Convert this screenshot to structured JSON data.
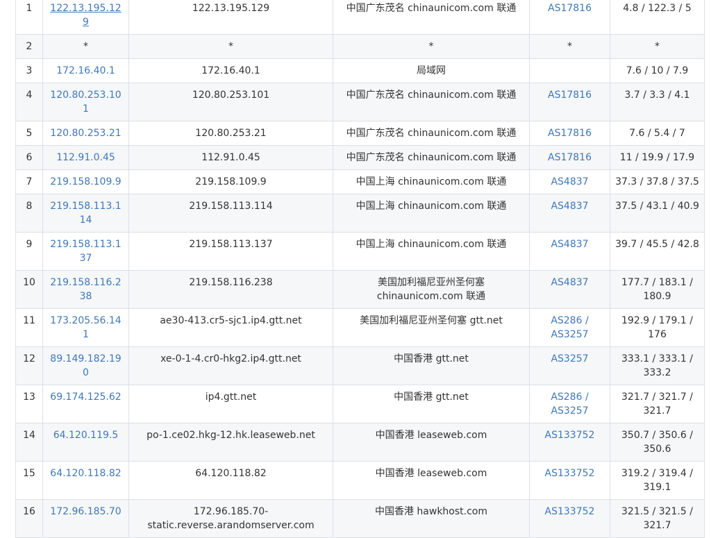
{
  "rows": [
    {
      "num": "1",
      "ip": "122.13.195.129",
      "host": "122.13.195.129",
      "loc": "中国广东茂名 chinaunicom.com 联通",
      "asn": "AS17816",
      "time": "4.8 / 122.3 / 5"
    },
    {
      "num": "2",
      "ip": "*",
      "host": "*",
      "loc": "*",
      "asn": "*",
      "time": "*"
    },
    {
      "num": "3",
      "ip": "172.16.40.1",
      "host": "172.16.40.1",
      "loc": "局域网",
      "asn": "",
      "time": "7.6 / 10 / 7.9"
    },
    {
      "num": "4",
      "ip": "120.80.253.101",
      "host": "120.80.253.101",
      "loc": "中国广东茂名 chinaunicom.com 联通",
      "asn": "AS17816",
      "time": "3.7 / 3.3 / 4.1"
    },
    {
      "num": "5",
      "ip": "120.80.253.21",
      "host": "120.80.253.21",
      "loc": "中国广东茂名 chinaunicom.com 联通",
      "asn": "AS17816",
      "time": "7.6 / 5.4 / 7"
    },
    {
      "num": "6",
      "ip": "112.91.0.45",
      "host": "112.91.0.45",
      "loc": "中国广东茂名 chinaunicom.com 联通",
      "asn": "AS17816",
      "time": "11 / 19.9 / 17.9"
    },
    {
      "num": "7",
      "ip": "219.158.109.9",
      "host": "219.158.109.9",
      "loc": "中国上海 chinaunicom.com 联通",
      "asn": "AS4837",
      "time": "37.3 / 37.8 / 37.5"
    },
    {
      "num": "8",
      "ip": "219.158.113.114",
      "host": "219.158.113.114",
      "loc": "中国上海 chinaunicom.com 联通",
      "asn": "AS4837",
      "time": "37.5 / 43.1 / 40.9"
    },
    {
      "num": "9",
      "ip": "219.158.113.137",
      "host": "219.158.113.137",
      "loc": "中国上海 chinaunicom.com 联通",
      "asn": "AS4837",
      "time": "39.7 / 45.5 / 42.8"
    },
    {
      "num": "10",
      "ip": "219.158.116.238",
      "host": "219.158.116.238",
      "loc": "美国加利福尼亚州圣何塞 chinaunicom.com 联通",
      "asn": "AS4837",
      "time": "177.7 / 183.1 / 180.9"
    },
    {
      "num": "11",
      "ip": "173.205.56.141",
      "host": "ae30-413.cr5-sjc1.ip4.gtt.net",
      "loc": "美国加利福尼亚州圣何塞 gtt.net",
      "asn": "AS286 / AS3257",
      "time": "192.9 / 179.1 / 176"
    },
    {
      "num": "12",
      "ip": "89.149.182.190",
      "host": "xe-0-1-4.cr0-hkg2.ip4.gtt.net",
      "loc": "中国香港 gtt.net",
      "asn": "AS3257",
      "time": "333.1 / 333.1 / 333.2"
    },
    {
      "num": "13",
      "ip": "69.174.125.62",
      "host": "ip4.gtt.net",
      "loc": "中国香港 gtt.net",
      "asn": "AS286 / AS3257",
      "time": "321.7 / 321.7 / 321.7"
    },
    {
      "num": "14",
      "ip": "64.120.119.5",
      "host": "po-1.ce02.hkg-12.hk.leaseweb.net",
      "loc": "中国香港 leaseweb.com",
      "asn": "AS133752",
      "time": "350.7 / 350.6 / 350.6"
    },
    {
      "num": "15",
      "ip": "64.120.118.82",
      "host": "64.120.118.82",
      "loc": "中国香港 leaseweb.com",
      "asn": "AS133752",
      "time": "319.2 / 319.4 / 319.1"
    },
    {
      "num": "16",
      "ip": "172.96.185.70",
      "host": "172.96.185.70-static.reverse.arandomserver.com",
      "loc": "中国香港 hawkhost.com",
      "asn": "AS133752",
      "time": "321.5 / 321.5 / 321.7"
    }
  ]
}
